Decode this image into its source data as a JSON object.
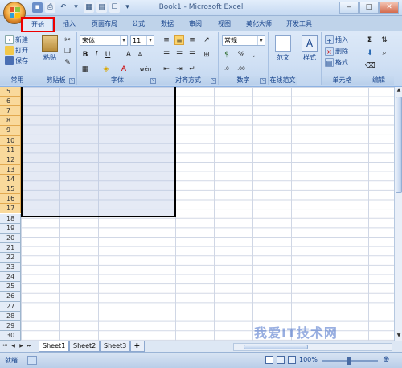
{
  "window": {
    "title": "Book1 - Microsoft Excel"
  },
  "tabs": [
    {
      "label": "开始",
      "active": true
    },
    {
      "label": "插入"
    },
    {
      "label": "页面布局"
    },
    {
      "label": "公式"
    },
    {
      "label": "数据"
    },
    {
      "label": "审阅"
    },
    {
      "label": "视图"
    },
    {
      "label": "美化大师"
    },
    {
      "label": "开发工具"
    }
  ],
  "ribbon": {
    "common": {
      "new": "新建",
      "open": "打开",
      "save": "保存",
      "label": "常用"
    },
    "clipboard": {
      "paste": "粘贴",
      "label": "剪贴板"
    },
    "font": {
      "name": "宋体",
      "size": "11",
      "bold": "B",
      "italic": "I",
      "underline": "U",
      "grow": "A",
      "shrink": "A",
      "color": "A",
      "phonetic": "wén",
      "label": "字体"
    },
    "alignment": {
      "label": "对齐方式"
    },
    "number": {
      "format": "常规",
      "percent": "%",
      "comma": ",",
      "label": "数字"
    },
    "online": {
      "template": "范文",
      "label": "在线范文"
    },
    "styles": {
      "style": "样式"
    },
    "cells": {
      "insert": "插入",
      "delete": "删除",
      "format": "格式",
      "label": "单元格"
    },
    "editing": {
      "sum": "Σ",
      "label": "编辑"
    }
  },
  "sheet": {
    "rows": [
      "5",
      "6",
      "7",
      "8",
      "9",
      "10",
      "11",
      "12",
      "13",
      "14",
      "15",
      "16",
      "17",
      "18",
      "19",
      "20",
      "21",
      "22",
      "23",
      "24",
      "25",
      "26",
      "27",
      "28",
      "29",
      "30"
    ],
    "selected_rows": [
      "5",
      "6",
      "7",
      "8",
      "9",
      "10",
      "11",
      "12",
      "13",
      "14",
      "15",
      "16",
      "17"
    ]
  },
  "sheet_tabs": [
    "Sheet1",
    "Sheet2",
    "Sheet3"
  ],
  "status": {
    "ready": "就绪",
    "zoom": "100%"
  },
  "watermark": "我爱IT技术网",
  "colors": {
    "accent": "#15428b",
    "selection_header": "#f9d99b",
    "highlight_box": "#e00000"
  }
}
